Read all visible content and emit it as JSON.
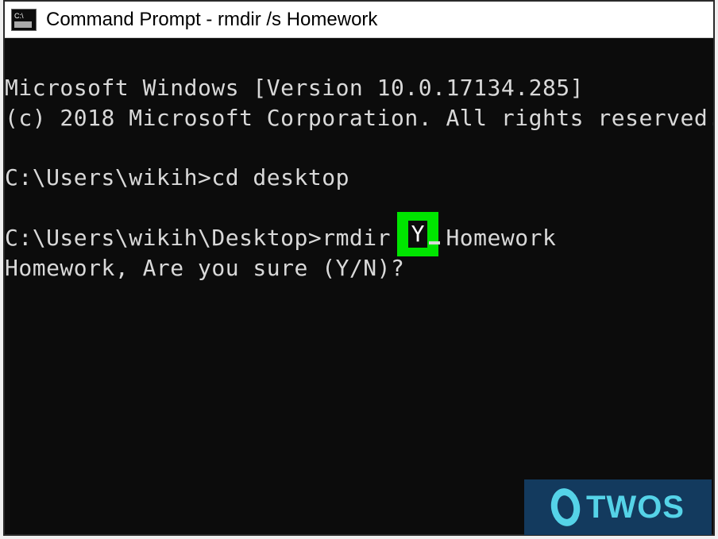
{
  "titlebar": {
    "title": "Command Prompt - rmdir  /s Homework"
  },
  "terminal": {
    "lines": [
      "Microsoft Windows [Version 10.0.17134.285]",
      "(c) 2018 Microsoft Corporation. All rights reserved.",
      "",
      "C:\\Users\\wikih>cd desktop",
      "",
      "C:\\Users\\wikih\\Desktop>rmdir /s Homework",
      "Homework, Are you sure (Y/N)?"
    ]
  },
  "highlight": {
    "char": "Y"
  },
  "watermark": {
    "text": "TWOS"
  }
}
